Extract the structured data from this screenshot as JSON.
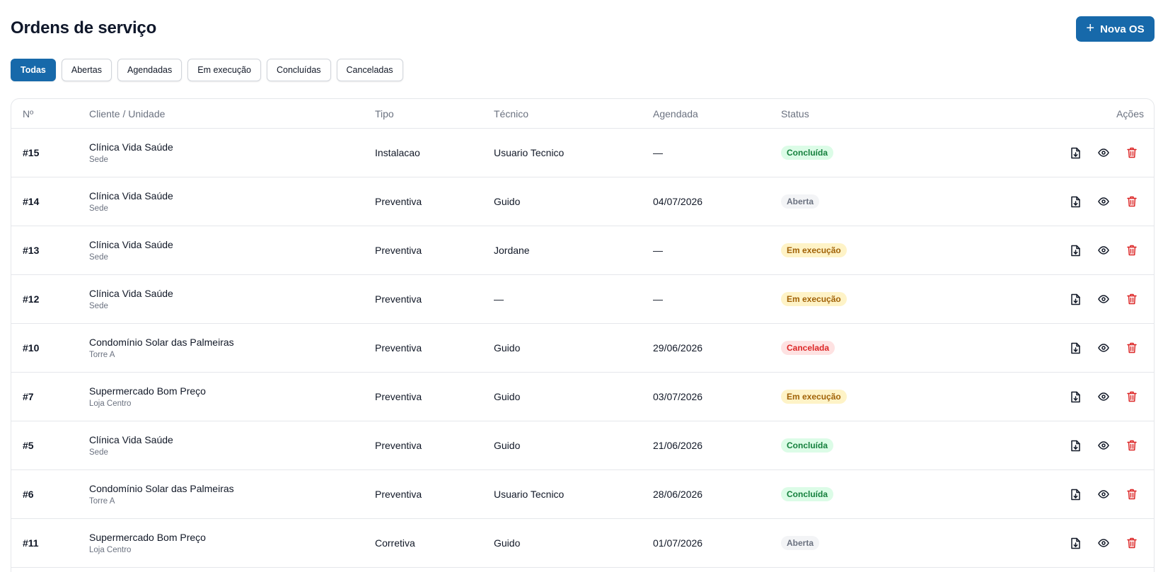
{
  "header": {
    "title": "Ordens de serviço",
    "new_button_label": "Nova OS"
  },
  "filters": [
    {
      "label": "Todas",
      "active": true
    },
    {
      "label": "Abertas",
      "active": false
    },
    {
      "label": "Agendadas",
      "active": false
    },
    {
      "label": "Em execução",
      "active": false
    },
    {
      "label": "Concluídas",
      "active": false
    },
    {
      "label": "Canceladas",
      "active": false
    }
  ],
  "table": {
    "columns": {
      "num": "Nº",
      "client": "Cliente / Unidade",
      "tipo": "Tipo",
      "tecnico": "Técnico",
      "agendada": "Agendada",
      "status": "Status",
      "acoes": "Ações"
    },
    "rows": [
      {
        "num": "#15",
        "client": "Clínica Vida Saúde",
        "unit": "Sede",
        "tipo": "Instalacao",
        "tecnico": "Usuario Tecnico",
        "agendada": "—",
        "status": "Concluída",
        "status_key": "concluida"
      },
      {
        "num": "#14",
        "client": "Clínica Vida Saúde",
        "unit": "Sede",
        "tipo": "Preventiva",
        "tecnico": "Guido",
        "agendada": "04/07/2026",
        "status": "Aberta",
        "status_key": "aberta"
      },
      {
        "num": "#13",
        "client": "Clínica Vida Saúde",
        "unit": "Sede",
        "tipo": "Preventiva",
        "tecnico": "Jordane",
        "agendada": "—",
        "status": "Em execução",
        "status_key": "exec"
      },
      {
        "num": "#12",
        "client": "Clínica Vida Saúde",
        "unit": "Sede",
        "tipo": "Preventiva",
        "tecnico": "—",
        "agendada": "—",
        "status": "Em execução",
        "status_key": "exec"
      },
      {
        "num": "#10",
        "client": "Condomínio Solar das Palmeiras",
        "unit": "Torre A",
        "tipo": "Preventiva",
        "tecnico": "Guido",
        "agendada": "29/06/2026",
        "status": "Cancelada",
        "status_key": "cancelada"
      },
      {
        "num": "#7",
        "client": "Supermercado Bom Preço",
        "unit": "Loja Centro",
        "tipo": "Preventiva",
        "tecnico": "Guido",
        "agendada": "03/07/2026",
        "status": "Em execução",
        "status_key": "exec"
      },
      {
        "num": "#5",
        "client": "Clínica Vida Saúde",
        "unit": "Sede",
        "tipo": "Preventiva",
        "tecnico": "Guido",
        "agendada": "21/06/2026",
        "status": "Concluída",
        "status_key": "concluida"
      },
      {
        "num": "#6",
        "client": "Condomínio Solar das Palmeiras",
        "unit": "Torre A",
        "tipo": "Preventiva",
        "tecnico": "Usuario Tecnico",
        "agendada": "28/06/2026",
        "status": "Concluída",
        "status_key": "concluida"
      },
      {
        "num": "#11",
        "client": "Supermercado Bom Preço",
        "unit": "Loja Centro",
        "tipo": "Corretiva",
        "tecnico": "Guido",
        "agendada": "01/07/2026",
        "status": "Aberta",
        "status_key": "aberta"
      }
    ]
  },
  "icons": {
    "download": "file-download-icon",
    "view": "eye-icon",
    "delete": "trash-icon"
  },
  "colors": {
    "primary": "#1769aa",
    "danger": "#dc2626",
    "concluida_bg": "#dcfce7",
    "exec_bg": "#fef3c7",
    "cancelada_bg": "#fee2e2",
    "aberta_bg": "#f3f4f6"
  }
}
